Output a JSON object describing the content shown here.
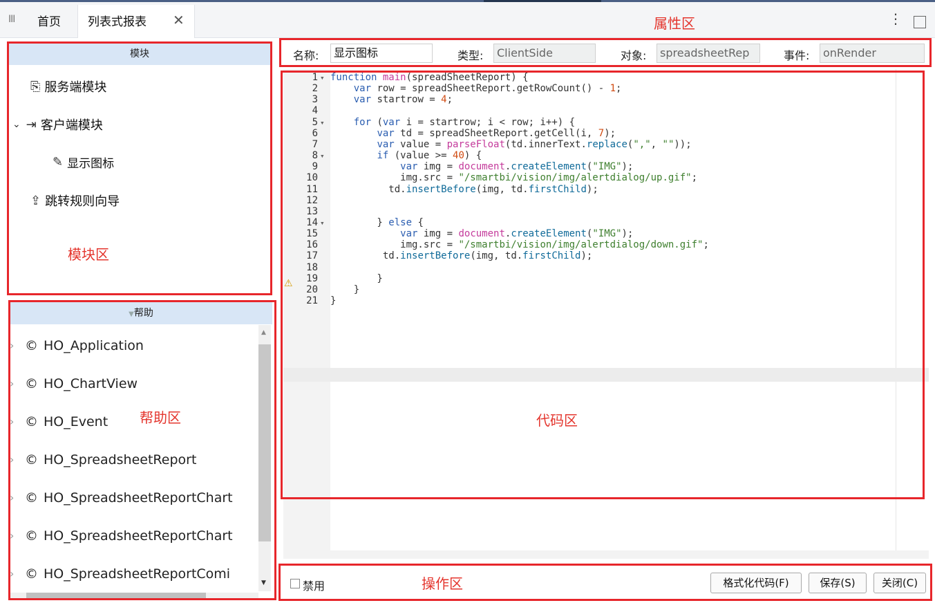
{
  "tabs": {
    "menu_icon": "III",
    "home": "首页",
    "active_label": "列表式报表",
    "close_icon": "✕",
    "more_icon": "⋮"
  },
  "annotations": {
    "property_area": "属性区",
    "module_area": "模块区",
    "help_area": "帮助区",
    "code_area": "代码区",
    "action_area": "操作区"
  },
  "modules": {
    "header": "模块",
    "items": [
      {
        "icon": "server-module-icon",
        "glyph": "⎘",
        "label": "服务端模块"
      },
      {
        "icon": "client-module-icon",
        "glyph": "⇥",
        "label": "客户端模块",
        "expanded": true
      },
      {
        "icon": "edit-script-icon",
        "glyph": "✎",
        "label": "显示图标"
      },
      {
        "icon": "jump-rule-icon",
        "glyph": "⇪",
        "label": "跳转规则向导"
      }
    ]
  },
  "help": {
    "header": "帮助",
    "items": [
      "HO_Application",
      "HO_ChartView",
      "HO_Event",
      "HO_SpreadsheetReport",
      "HO_SpreadsheetReportChart",
      "HO_SpreadsheetReportChart",
      "HO_SpreadsheetReportComi"
    ]
  },
  "properties": {
    "name_label": "名称:",
    "name_value": "显示图标",
    "type_label": "类型:",
    "type_value": "ClientSide",
    "object_label": "对象:",
    "object_value": "spreadsheetRep",
    "event_label": "事件:",
    "event_value": "onRender"
  },
  "code": {
    "lines": [
      "function main(spreadSheetReport) {",
      "    var row = spreadSheetReport.getRowCount() - 1;",
      "    var startrow = 4;",
      "",
      "    for (var i = startrow; i < row; i++) {",
      "        var td = spreadSheetReport.getCell(i, 7);",
      "        var value = parseFloat(td.innerText.replace(\",\", \"\"));",
      "        if (value >= 40) {",
      "            var img = document.createElement(\"IMG\");",
      "            img.src = \"/smartbi/vision/img/alertdialog/up.gif\";",
      "          td.insertBefore(img, td.firstChild);",
      "",
      "",
      "        } else {",
      "            var img = document.createElement(\"IMG\");",
      "            img.src = \"/smartbi/vision/img/alertdialog/down.gif\";",
      "         td.insertBefore(img, td.firstChild);",
      "",
      "        }",
      "    }",
      "}"
    ],
    "line_numbers": [
      "1",
      "2",
      "3",
      "4",
      "5",
      "6",
      "7",
      "8",
      "9",
      "10",
      "11",
      "12",
      "13",
      "14",
      "15",
      "16",
      "17",
      "18",
      "19",
      "20",
      "21"
    ],
    "folds": [
      "▾",
      "",
      "",
      "",
      "▾",
      "",
      "",
      "▾",
      "",
      "",
      "",
      "",
      "",
      "▾",
      "",
      "",
      "",
      "",
      "",
      "",
      ""
    ],
    "warning_icon": "⚠"
  },
  "actions": {
    "disable_label": "禁用",
    "format_button": "格式化代码(F)",
    "save_button": "保存(S)",
    "close_button": "关闭(C)"
  },
  "colors": {
    "annotation_red": "#e7262b",
    "panel_header_blue": "#d8e6f6",
    "keyword_blue": "#2a5db0"
  }
}
